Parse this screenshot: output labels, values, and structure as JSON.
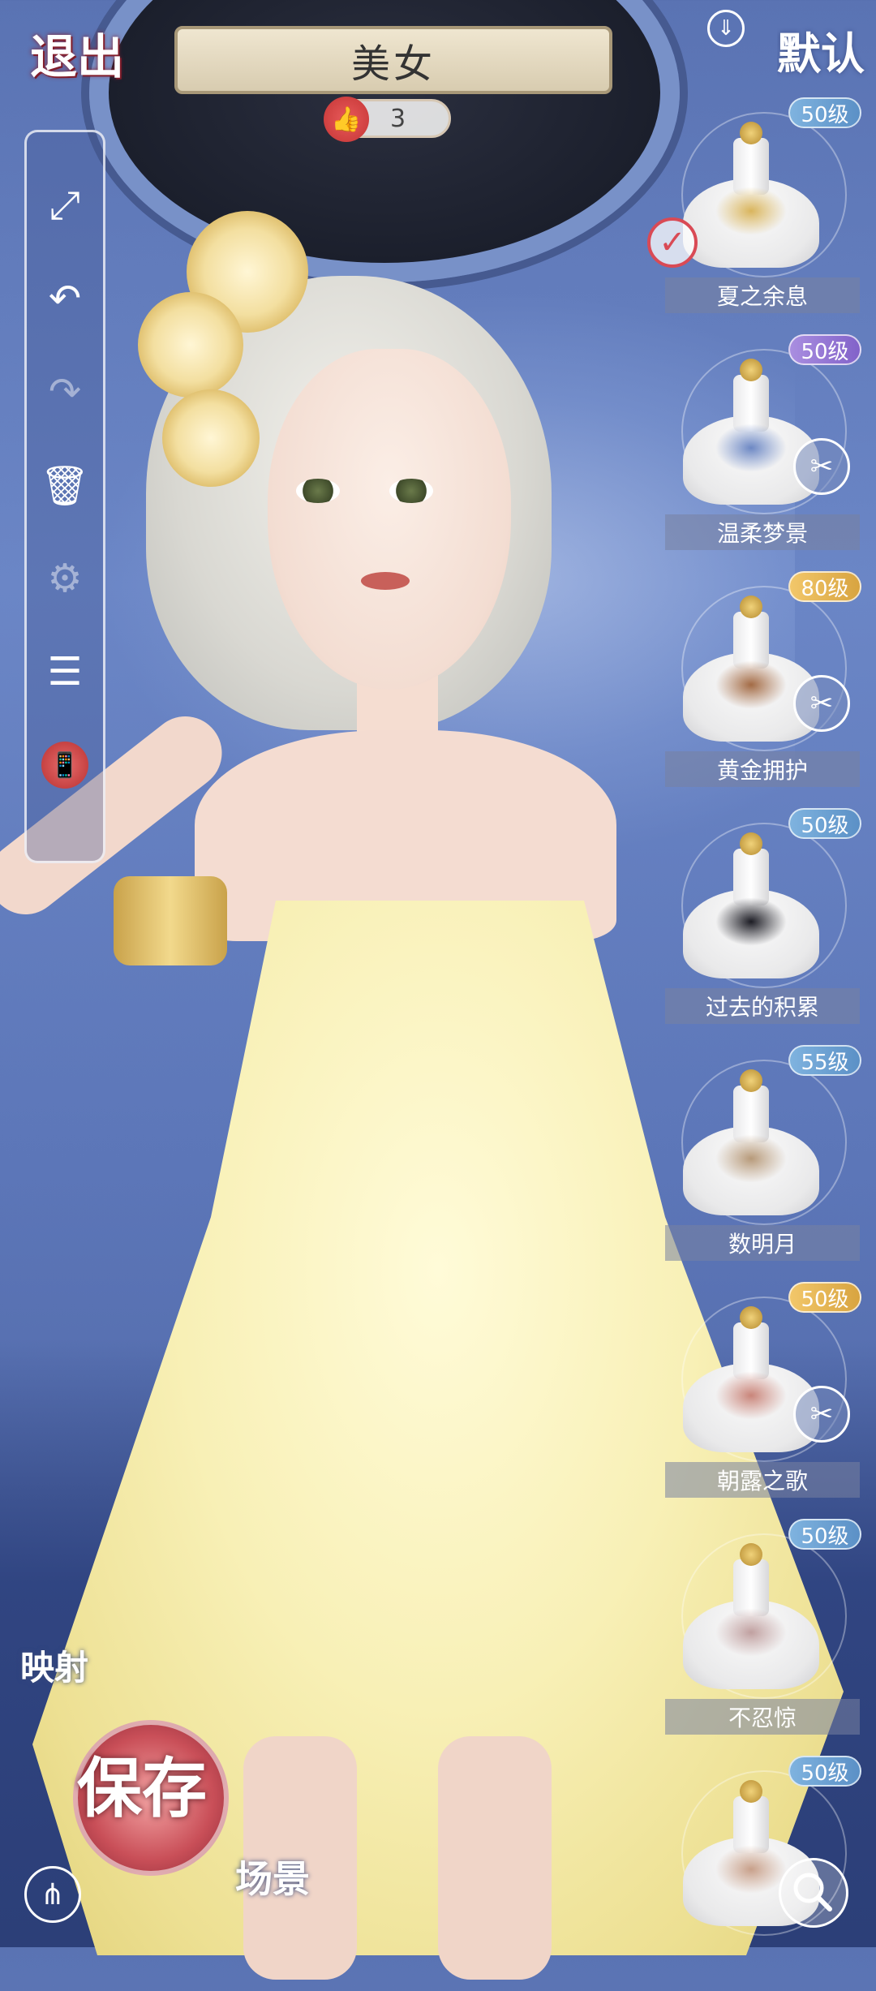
{
  "header": {
    "exit_label": "退出",
    "title": "美女",
    "likes": "3",
    "default_label": "默认"
  },
  "toolbar": {
    "items": [
      {
        "icon": "fullscreen-icon",
        "glyph": "⤢"
      },
      {
        "icon": "undo-icon",
        "glyph": "↶"
      },
      {
        "icon": "redo-icon",
        "glyph": "↷"
      },
      {
        "icon": "trash-icon",
        "glyph": "🗑"
      },
      {
        "icon": "settings-icon",
        "glyph": "⚙"
      },
      {
        "icon": "list-icon",
        "glyph": "☰"
      },
      {
        "icon": "phone-icon",
        "glyph": "📱"
      }
    ]
  },
  "items": [
    {
      "name": "夏之余息",
      "level": "50级",
      "level_color": "blue",
      "selected": true,
      "machine": false,
      "accent": "#d9b55d"
    },
    {
      "name": "温柔梦景",
      "level": "50级",
      "level_color": "purple",
      "selected": false,
      "machine": true,
      "accent": "#6d88c4"
    },
    {
      "name": "黄金拥护",
      "level": "80级",
      "level_color": "gold",
      "selected": false,
      "machine": true,
      "accent": "#a36b45"
    },
    {
      "name": "过去的积累",
      "level": "50级",
      "level_color": "blue",
      "selected": false,
      "machine": false,
      "accent": "#1c1c24"
    },
    {
      "name": "数明月",
      "level": "55级",
      "level_color": "blue",
      "selected": false,
      "machine": false,
      "accent": "#b79a7a"
    },
    {
      "name": "朝露之歌",
      "level": "50级",
      "level_color": "gold",
      "selected": false,
      "machine": true,
      "accent": "#c9857a"
    },
    {
      "name": "不忍惊",
      "level": "50级",
      "level_color": "blue",
      "selected": false,
      "machine": false,
      "accent": "#c0a0a0"
    },
    {
      "name": "",
      "level": "50级",
      "level_color": "blue",
      "selected": false,
      "machine": false,
      "accent": "#c8a08a"
    }
  ],
  "bottom": {
    "mapping_label": "映射",
    "save_label": "保存",
    "scene_label": "场景"
  },
  "colors": {
    "background": "#5a73b3",
    "dress": "#f8f0b6",
    "accent_red": "#d94a55"
  }
}
